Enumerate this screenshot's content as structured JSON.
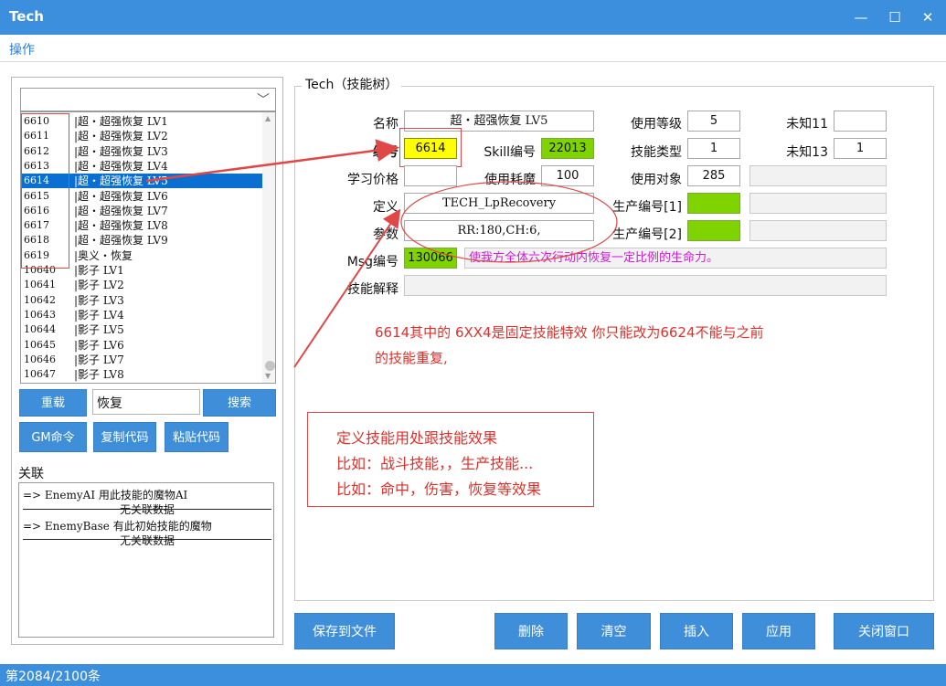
{
  "window": {
    "title": "Tech",
    "minimize_glyph": "—",
    "maximize_glyph": "☐",
    "close_glyph": "✕"
  },
  "menu": {
    "ops": "操作"
  },
  "list": {
    "items": [
      {
        "id": "6610",
        "name": "|超・超强恢复 LV1"
      },
      {
        "id": "6611",
        "name": "|超・超强恢复 LV2"
      },
      {
        "id": "6612",
        "name": "|超・超强恢复 LV3"
      },
      {
        "id": "6613",
        "name": "|超・超强恢复 LV4"
      },
      {
        "id": "6614",
        "name": "|超・超强恢复 LV5"
      },
      {
        "id": "6615",
        "name": "|超・超强恢复 LV6"
      },
      {
        "id": "6616",
        "name": "|超・超强恢复 LV7"
      },
      {
        "id": "6617",
        "name": "|超・超强恢复 LV8"
      },
      {
        "id": "6618",
        "name": "|超・超强恢复 LV9"
      },
      {
        "id": "6619",
        "name": "|奥义・恢复"
      },
      {
        "id": "10640",
        "name": "|影子 LV1"
      },
      {
        "id": "10641",
        "name": "|影子 LV2"
      },
      {
        "id": "10642",
        "name": "|影子 LV3"
      },
      {
        "id": "10643",
        "name": "|影子 LV4"
      },
      {
        "id": "10644",
        "name": "|影子 LV5"
      },
      {
        "id": "10645",
        "name": "|影子 LV6"
      },
      {
        "id": "10646",
        "name": "|影子 LV7"
      },
      {
        "id": "10647",
        "name": "|影子 LV8"
      }
    ],
    "selected_index": 4
  },
  "buttons": {
    "reload": "重载",
    "search": "搜索",
    "gm": "GM命令",
    "copy_code": "复制代码",
    "paste_code": "粘贴代码",
    "save_file": "保存到文件",
    "delete": "删除",
    "clear": "清空",
    "insert": "插入",
    "apply": "应用",
    "close_window": "关闭窗口"
  },
  "search": {
    "value": "恢复"
  },
  "relation": {
    "label": "关联",
    "lines": [
      "=> EnemyAI 用此技能的魔物AI",
      "无关联数据",
      "=> EnemyBase 有此初始技能的魔物",
      "无关联数据"
    ]
  },
  "group_title": "Tech（技能树）",
  "form": {
    "name_label": "名称",
    "name_value": "超・超强恢复 LV5",
    "use_level_label": "使用等级",
    "use_level_value": "5",
    "unknown11_label": "未知11",
    "unknown11_value": "",
    "id_label": "编号",
    "id_value": "6614",
    "skill_id_label": "Skill编号",
    "skill_id_value": "22013",
    "skill_type_label": "技能类型",
    "skill_type_value": "1",
    "unknown13_label": "未知13",
    "unknown13_value": "1",
    "learn_price_label": "学习价格",
    "learn_price_value": "",
    "use_cost_label": "使用耗魔",
    "use_cost_value": "100",
    "use_target_label": "使用对象",
    "use_target_value": "285",
    "define_label": "定义",
    "define_value": "TECH_LpRecovery",
    "prod1_label": "生产编号[1]",
    "param_label": "参数",
    "param_value": "RR:180,CH:6,",
    "prod2_label": "生产编号[2]",
    "msg_label": "Msg编号",
    "msg_value": "130066",
    "msg_text": "使我方全体六次行动内恢复一定比例的生命力。",
    "desc_label": "技能解释"
  },
  "annotations": {
    "note1_line1": "6614其中的 6XX4是固定技能特效 你只能改为6624不能与之前",
    "note1_line2": "的技能重复,",
    "note2_line1": "定义技能用处跟技能效果",
    "note2_line2": "比如：战斗技能，，生产技能...",
    "note2_line3": "比如：命中，伤害，恢复等效果"
  },
  "status": {
    "text": "第2084/2100条"
  },
  "colors": {
    "accent": "#3b8fdc",
    "selection": "#0a6fd0",
    "green_field": "#7fd400",
    "yellow_field": "#ffff00",
    "annotation_red": "#e0302b",
    "msg_magenta": "#d01ad9"
  }
}
